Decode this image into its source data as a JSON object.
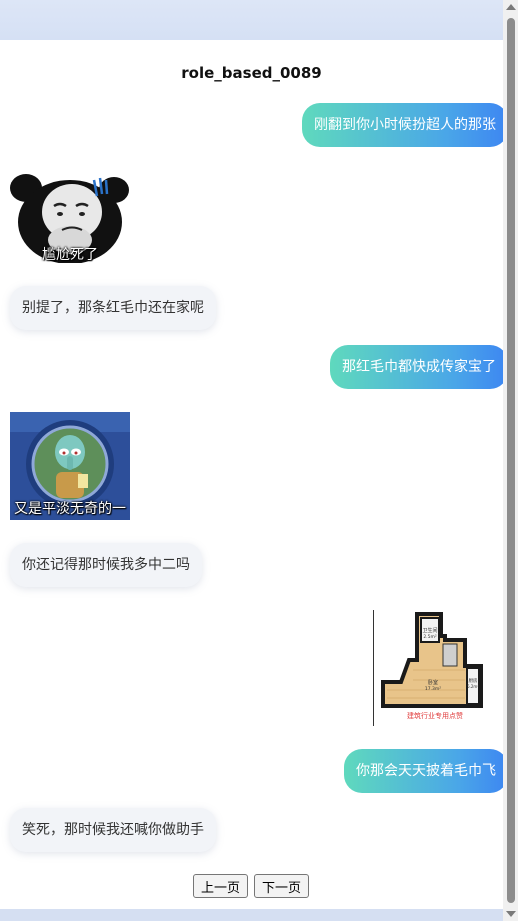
{
  "title": "role_based_0089",
  "messages": [
    {
      "type": "text",
      "side": "right",
      "text": "刚翻到你小时候扮超人的那张"
    },
    {
      "type": "sticker",
      "side": "left",
      "icon": "panda-meme-icon",
      "caption": "尴尬死了"
    },
    {
      "type": "text",
      "side": "left",
      "text": "别提了，那条红毛巾还在家呢"
    },
    {
      "type": "text",
      "side": "right",
      "text": "那红毛巾都快成传家宝了"
    },
    {
      "type": "sticker",
      "side": "left",
      "icon": "squidward-window-icon",
      "caption": "又是平淡无奇的一天"
    },
    {
      "type": "text",
      "side": "left",
      "text": "你还记得那时候我多中二吗"
    },
    {
      "type": "image",
      "side": "right",
      "icon": "floor-plan-icon",
      "labels": [
        "卫生间",
        "2.5m²",
        "卧室",
        "17.3m²",
        "厨房",
        "5.2m²"
      ],
      "watermark": "建筑行业专用点赞"
    },
    {
      "type": "text",
      "side": "right",
      "text": "你那会天天披着毛巾飞"
    },
    {
      "type": "text",
      "side": "left",
      "text": "笑死，那时候我还喊你做助手"
    }
  ],
  "pagination": {
    "prev_label": "上一页",
    "next_label": "下一页"
  }
}
